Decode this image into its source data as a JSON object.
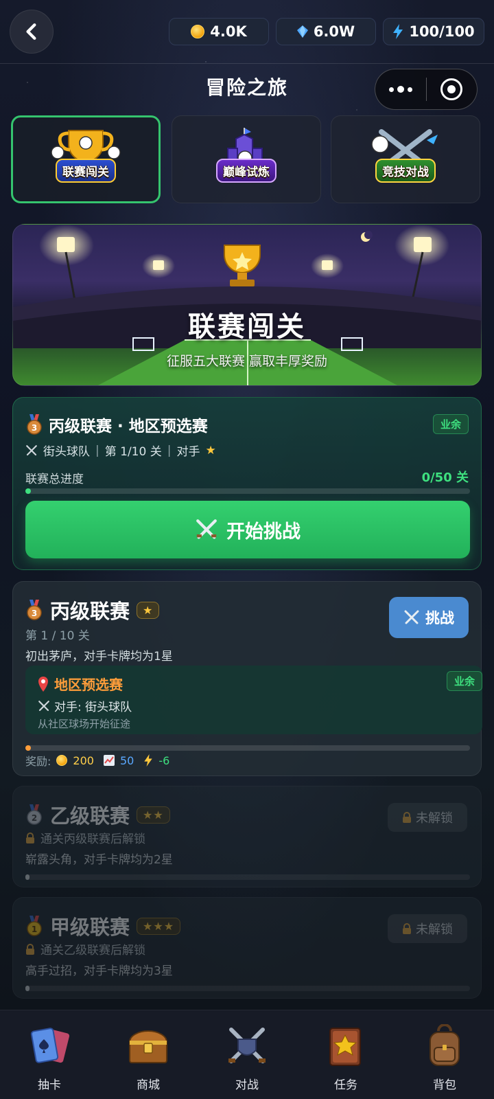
{
  "header": {
    "resources": [
      {
        "icon": "coin-icon",
        "value": "4.0K"
      },
      {
        "icon": "gem-icon",
        "value": "6.0W"
      },
      {
        "icon": "energy-icon",
        "value": "100/100"
      }
    ],
    "title": "冒险之旅"
  },
  "mode_tabs": [
    {
      "label": "联赛闯关",
      "active": true
    },
    {
      "label": "巅峰试炼",
      "active": false
    },
    {
      "label": "竞技对战",
      "active": false
    }
  ],
  "banner": {
    "title": "联赛闯关",
    "subtitle": "征服五大联赛 赢取丰厚奖励"
  },
  "current": {
    "title": "丙级联赛 · 地区预选赛",
    "tag": "业余",
    "team": "街头球队",
    "level": "第 1/10 关",
    "opponent_label": "对手",
    "progress_label": "联赛总进度",
    "progress_value": "0/50 关",
    "progress_fraction": 0,
    "start_button": "开始挑战"
  },
  "leagues": [
    {
      "name": "丙级联赛",
      "stars": "★",
      "level": "第 1 / 10 关",
      "desc": "初出茅庐，对手卡牌均为1星",
      "challenge_button": "挑战",
      "stage": {
        "name": "地区预选赛",
        "tag": "业余",
        "opponent": "对手: 街头球队",
        "note": "从社区球场开始征途"
      },
      "reward_label": "奖励:",
      "rewards": {
        "coins": "200",
        "exp": "50",
        "energy": "-6"
      }
    },
    {
      "name": "乙级联赛",
      "stars": "★★",
      "unlock": "通关丙级联赛后解锁",
      "desc": "崭露头角，对手卡牌均为2星",
      "locked_label": "未解锁"
    },
    {
      "name": "甲级联赛",
      "stars": "★★★",
      "unlock": "通关乙级联赛后解锁",
      "desc": "高手过招，对手卡牌均为3星",
      "locked_label": "未解锁"
    }
  ],
  "bottom_nav": [
    {
      "label": "抽卡",
      "icon": "cards-icon"
    },
    {
      "label": "商城",
      "icon": "chest-icon"
    },
    {
      "label": "对战",
      "icon": "crossed-swords-icon"
    },
    {
      "label": "任务",
      "icon": "star-book-icon"
    },
    {
      "label": "背包",
      "icon": "backpack-icon"
    }
  ],
  "colors": {
    "accent_green": "#35c46e",
    "challenge_blue": "#4a8ad0",
    "stage_orange": "#ff9d3a",
    "star_gold": "#ffc83d"
  }
}
